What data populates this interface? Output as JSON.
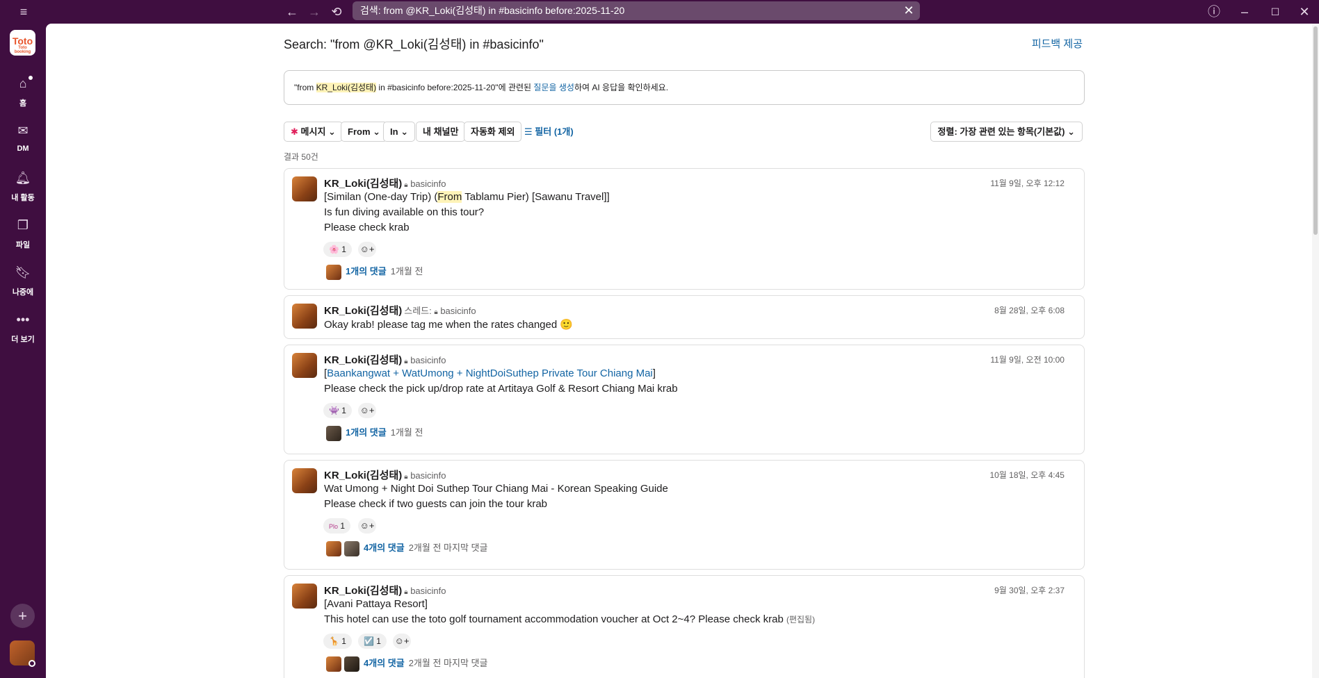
{
  "topbar": {
    "menu_icon": "hamburger-icon",
    "search_text": "검색: from @KR_Loki(김성태) in #basicinfo before:2025-11-20",
    "help_icon": "help-icon"
  },
  "rail": {
    "logo_text": "Toto",
    "logo_sub": "Toto booking",
    "items": [
      {
        "label": "홈",
        "icon": "home-icon"
      },
      {
        "label": "DM",
        "icon": "dm-icon"
      },
      {
        "label": "내 활동",
        "icon": "bell-icon"
      },
      {
        "label": "파일",
        "icon": "files-icon"
      },
      {
        "label": "나중에",
        "icon": "bookmark-icon"
      },
      {
        "label": "더 보기",
        "icon": "more-icon"
      }
    ]
  },
  "header": {
    "title": "Search: \"from @KR_Loki(김성태) in #basicinfo\"",
    "feedback": "피드백 제공"
  },
  "ai_prompt": {
    "q_open": "\"from ",
    "q_user": "KR_Loki(김성태)",
    "q_rest": " in #basicinfo before:2025-11-20\"",
    "mid": "에 관련된 ",
    "link": "질문을 생성",
    "tail": "하여 AI 응답을 확인하세요."
  },
  "filters": {
    "messages": "메시지",
    "from": "From",
    "in": "In",
    "my_channels": "내 채널만",
    "exclude_auto": "자동화 제외",
    "filter": "필터 (1개)",
    "sort": "정렬: 가장 관련 있는 항목(기본값)"
  },
  "result_count": "결과 50건",
  "results": [
    {
      "author": "KR_Loki(김성태)",
      "prefix": "",
      "channel": "basicinfo",
      "time": "11월 9일, 오후 12:12",
      "line1_a": "[Similan (One-day Trip) (",
      "line1_hl": "From",
      "line1_b": " Tablamu Pier) [Sawanu Travel]]",
      "line2": "Is fun diving available on this tour?",
      "line3": "Please check krab",
      "reaction1_emoji": "🌸",
      "reaction1_count": "1",
      "thread_link": "1개의 댓글",
      "thread_meta": "1개월 전"
    },
    {
      "author": "KR_Loki(김성태)",
      "prefix": "스레드:",
      "channel": "basicinfo",
      "time": "8월 28일, 오후 6:08",
      "line1": "Okay krab! please tag me when the rates changed",
      "emoji": "🙂"
    },
    {
      "author": "KR_Loki(김성태)",
      "prefix": "",
      "channel": "basicinfo",
      "time": "11월 9일, 오전 10:00",
      "line1_open": "[",
      "line1_link": "Baankangwat + WatUmong + NightDoiSuthep Private Tour Chiang Mai",
      "line1_close": "]",
      "line2": "Please check the pick up/drop rate at Artitaya Golf & Resort Chiang Mai krab",
      "reaction1_emoji": "👾",
      "reaction1_count": "1",
      "thread_link": "1개의 댓글",
      "thread_meta": "1개월 전"
    },
    {
      "author": "KR_Loki(김성태)",
      "prefix": "",
      "channel": "basicinfo",
      "time": "10월 18일, 오후 4:45",
      "line1": "Wat Umong + Night Doi Suthep Tour Chiang Mai - Korean Speaking Guide",
      "line2": "Please check if two guests can join the tour krab",
      "reaction1_emoji": "Plo",
      "reaction1_count": "1",
      "thread_link": "4개의 댓글",
      "thread_meta": "2개월 전 마지막 댓글"
    },
    {
      "author": "KR_Loki(김성태)",
      "prefix": "",
      "channel": "basicinfo",
      "time": "9월 30일, 오후 2:37",
      "line1": "[Avani Pattaya Resort]",
      "line2": "This hotel can use the toto golf tournament accommodation voucher at Oct 2~4? Please check krab",
      "edited": "(편집됨)",
      "reaction1_emoji": "🦒",
      "reaction1_count": "1",
      "reaction2_emoji": "☑️",
      "reaction2_count": "1",
      "thread_link": "4개의 댓글",
      "thread_meta": "2개월 전 마지막 댓글"
    }
  ]
}
